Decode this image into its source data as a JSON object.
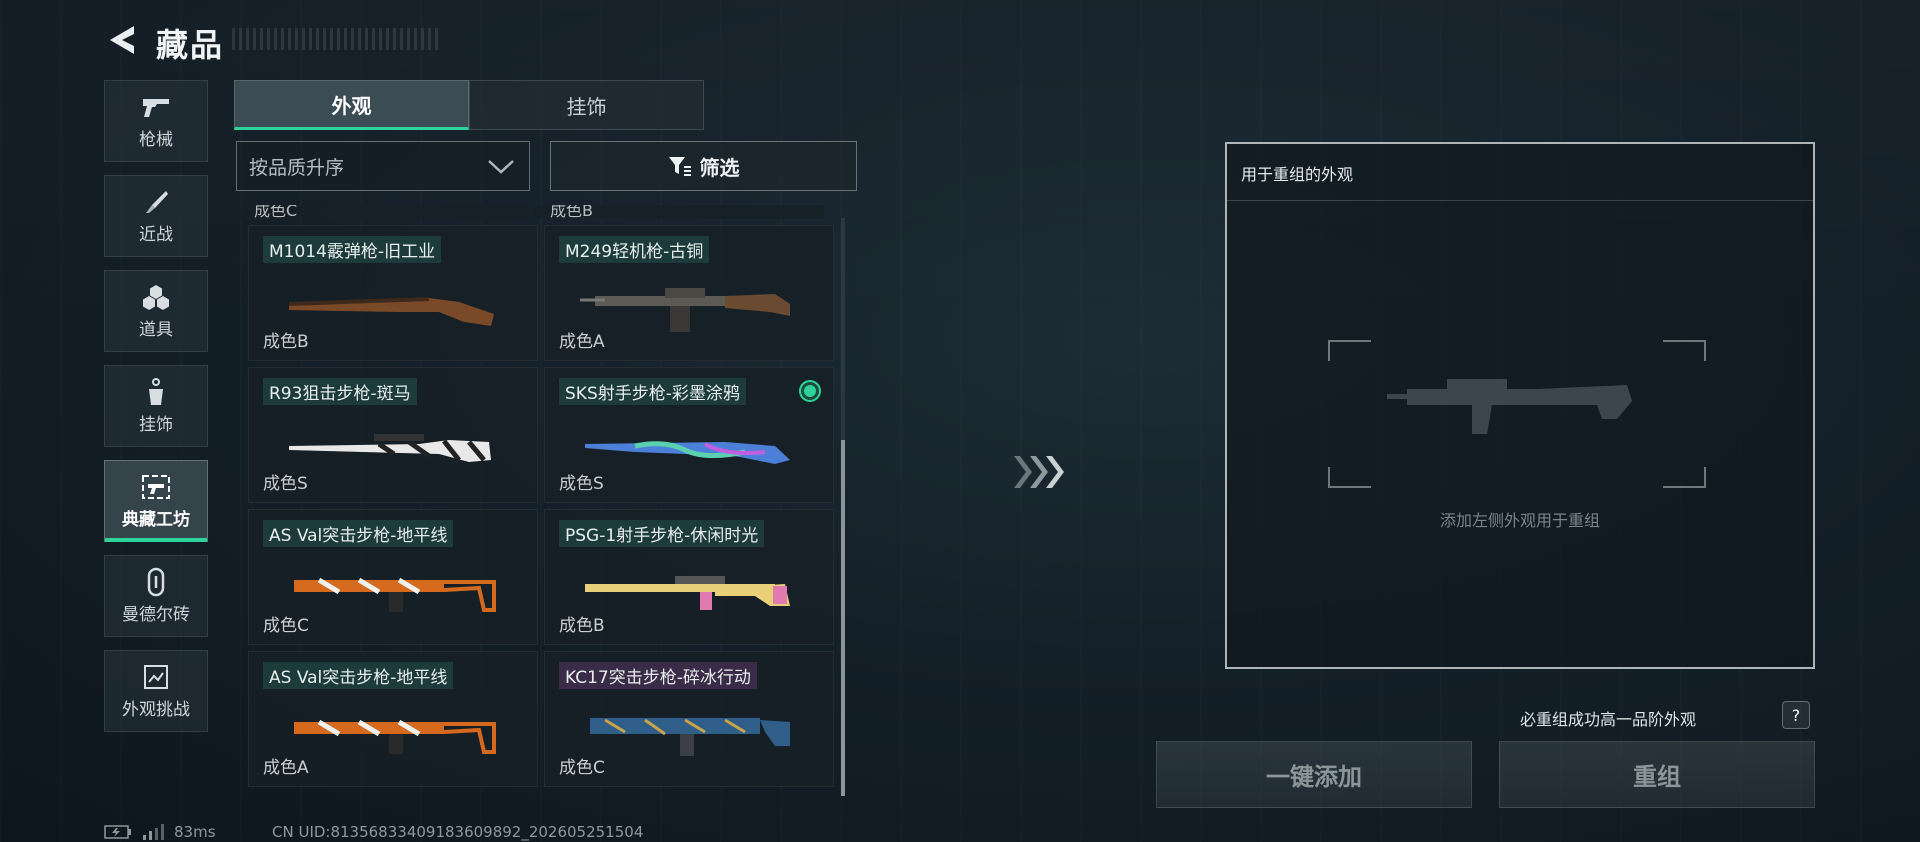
{
  "header": {
    "title": "藏品"
  },
  "sidebar": {
    "items": [
      {
        "label": "枪械",
        "icon": "pistol-icon"
      },
      {
        "label": "近战",
        "icon": "knife-icon"
      },
      {
        "label": "道具",
        "icon": "cubes-icon"
      },
      {
        "label": "挂饰",
        "icon": "charm-icon"
      },
      {
        "label": "典藏工坊",
        "icon": "workshop-icon",
        "active": true
      },
      {
        "label": "曼德尔砖",
        "icon": "mandel-brick-icon"
      },
      {
        "label": "外观挑战",
        "icon": "challenge-icon"
      }
    ]
  },
  "tabs": [
    {
      "label": "外观",
      "active": true
    },
    {
      "label": "挂饰",
      "active": false
    }
  ],
  "sort": {
    "label": "按品质升序"
  },
  "filter": {
    "label": "筛选"
  },
  "grid": {
    "partial_top": [
      "成色C",
      "成色B"
    ],
    "items": [
      {
        "name": "M1014霰弹枪-旧工业",
        "quality": "成色B"
      },
      {
        "name": "M249轻机枪-古铜",
        "quality": "成色A"
      },
      {
        "name": "R93狙击步枪-斑马",
        "quality": "成色S"
      },
      {
        "name": "SKS射手步枪-彩墨涂鸦",
        "quality": "成色S",
        "selected": true
      },
      {
        "name": "AS Val突击步枪-地平线",
        "quality": "成色C"
      },
      {
        "name": "PSG-1射手步枪-休闲时光",
        "quality": "成色B"
      },
      {
        "name": "AS Val突击步枪-地平线",
        "quality": "成色A"
      },
      {
        "name": "KC17突击步枪-碎冰行动",
        "quality": "成色C"
      }
    ]
  },
  "recombine": {
    "panel_title": "用于重组的外观",
    "hint": "添加左侧外观用于重组",
    "note": "必重组成功高一品阶外观",
    "help": "?",
    "add_all_label": "一键添加",
    "recombine_label": "重组"
  },
  "status": {
    "latency": "83ms",
    "uid": "CN UID:8135683340918360989​2_202605251504"
  },
  "colors": {
    "accent": "#2ed39a",
    "name_tag": "#1d3b3a",
    "name_tag_purple": "#3a2c48"
  }
}
